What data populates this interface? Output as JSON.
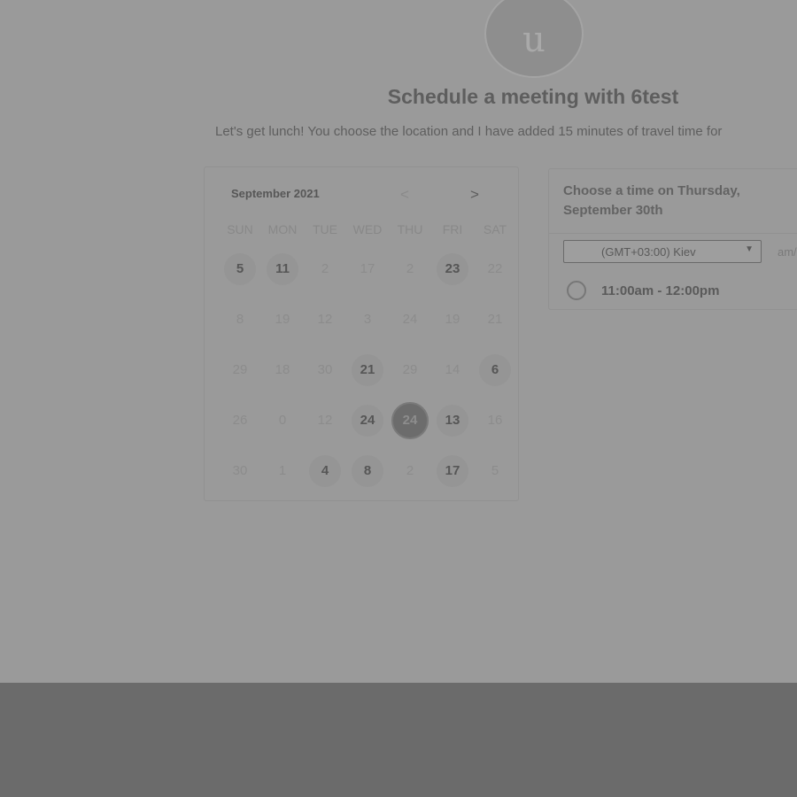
{
  "header": {
    "avatar_letter": "u",
    "title": "Schedule a meeting with 6test",
    "subtitle": "Let's get lunch! You choose the location and I have added 15 minutes of travel time for"
  },
  "calendar": {
    "month_label": "September 2021",
    "prev_label": "<",
    "next_label": ">",
    "weekdays": [
      "SUN",
      "MON",
      "TUE",
      "WED",
      "THU",
      "FRI",
      "SAT"
    ],
    "weeks": [
      [
        {
          "n": "5",
          "s": "avail"
        },
        {
          "n": "11",
          "s": "avail"
        },
        {
          "n": "2",
          "s": "off"
        },
        {
          "n": "17",
          "s": "off"
        },
        {
          "n": "2",
          "s": "off"
        },
        {
          "n": "23",
          "s": "avail"
        },
        {
          "n": "22",
          "s": "off"
        }
      ],
      [
        {
          "n": "8",
          "s": "off"
        },
        {
          "n": "19",
          "s": "off"
        },
        {
          "n": "12",
          "s": "off"
        },
        {
          "n": "3",
          "s": "off"
        },
        {
          "n": "24",
          "s": "off"
        },
        {
          "n": "19",
          "s": "off"
        },
        {
          "n": "21",
          "s": "off"
        }
      ],
      [
        {
          "n": "29",
          "s": "off"
        },
        {
          "n": "18",
          "s": "off"
        },
        {
          "n": "30",
          "s": "off"
        },
        {
          "n": "21",
          "s": "avail"
        },
        {
          "n": "29",
          "s": "off"
        },
        {
          "n": "14",
          "s": "off"
        },
        {
          "n": "6",
          "s": "avail"
        }
      ],
      [
        {
          "n": "26",
          "s": "off"
        },
        {
          "n": "0",
          "s": "off"
        },
        {
          "n": "12",
          "s": "off"
        },
        {
          "n": "24",
          "s": "avail"
        },
        {
          "n": "24",
          "s": "selected"
        },
        {
          "n": "13",
          "s": "avail"
        },
        {
          "n": "16",
          "s": "off"
        }
      ],
      [
        {
          "n": "30",
          "s": "off"
        },
        {
          "n": "1",
          "s": "off"
        },
        {
          "n": "4",
          "s": "avail"
        },
        {
          "n": "8",
          "s": "avail"
        },
        {
          "n": "2",
          "s": "off"
        },
        {
          "n": "17",
          "s": "avail"
        },
        {
          "n": "5",
          "s": "off"
        }
      ]
    ]
  },
  "time_panel": {
    "heading": "Choose a time on Thursday, September 30th",
    "timezone": "(GMT+03:00) Kiev",
    "ampm_label": "am/",
    "slots": [
      "11:00am - 12:00pm"
    ]
  }
}
